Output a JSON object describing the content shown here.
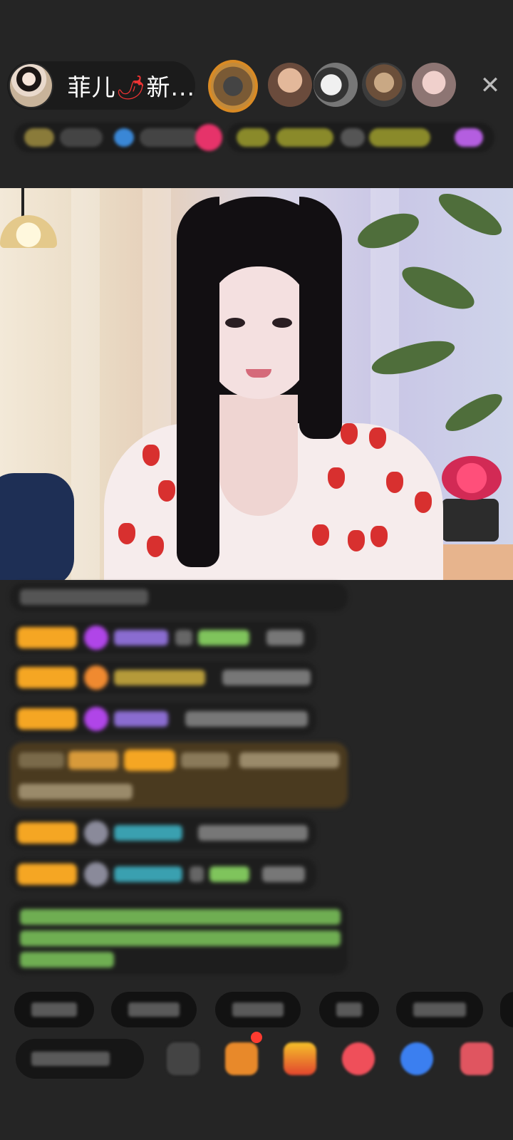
{
  "host": {
    "name": "菲儿",
    "name_icon": "🌶",
    "name_suffix": "新...",
    "avatar": "host-avatar-icon"
  },
  "top_bar": {
    "viewers": [
      "viewer-avatar",
      "viewer-avatar",
      "viewer-avatar",
      "viewer-avatar",
      "viewer-avatar"
    ],
    "close_icon": "close-icon",
    "close_glyph": "✕"
  },
  "colors": {
    "background": "#252525",
    "badge": "#f5a623",
    "purple_gem": "#b045e8",
    "highlight_msg": "#4a3a1f",
    "accent_red": "#ff3b30"
  }
}
